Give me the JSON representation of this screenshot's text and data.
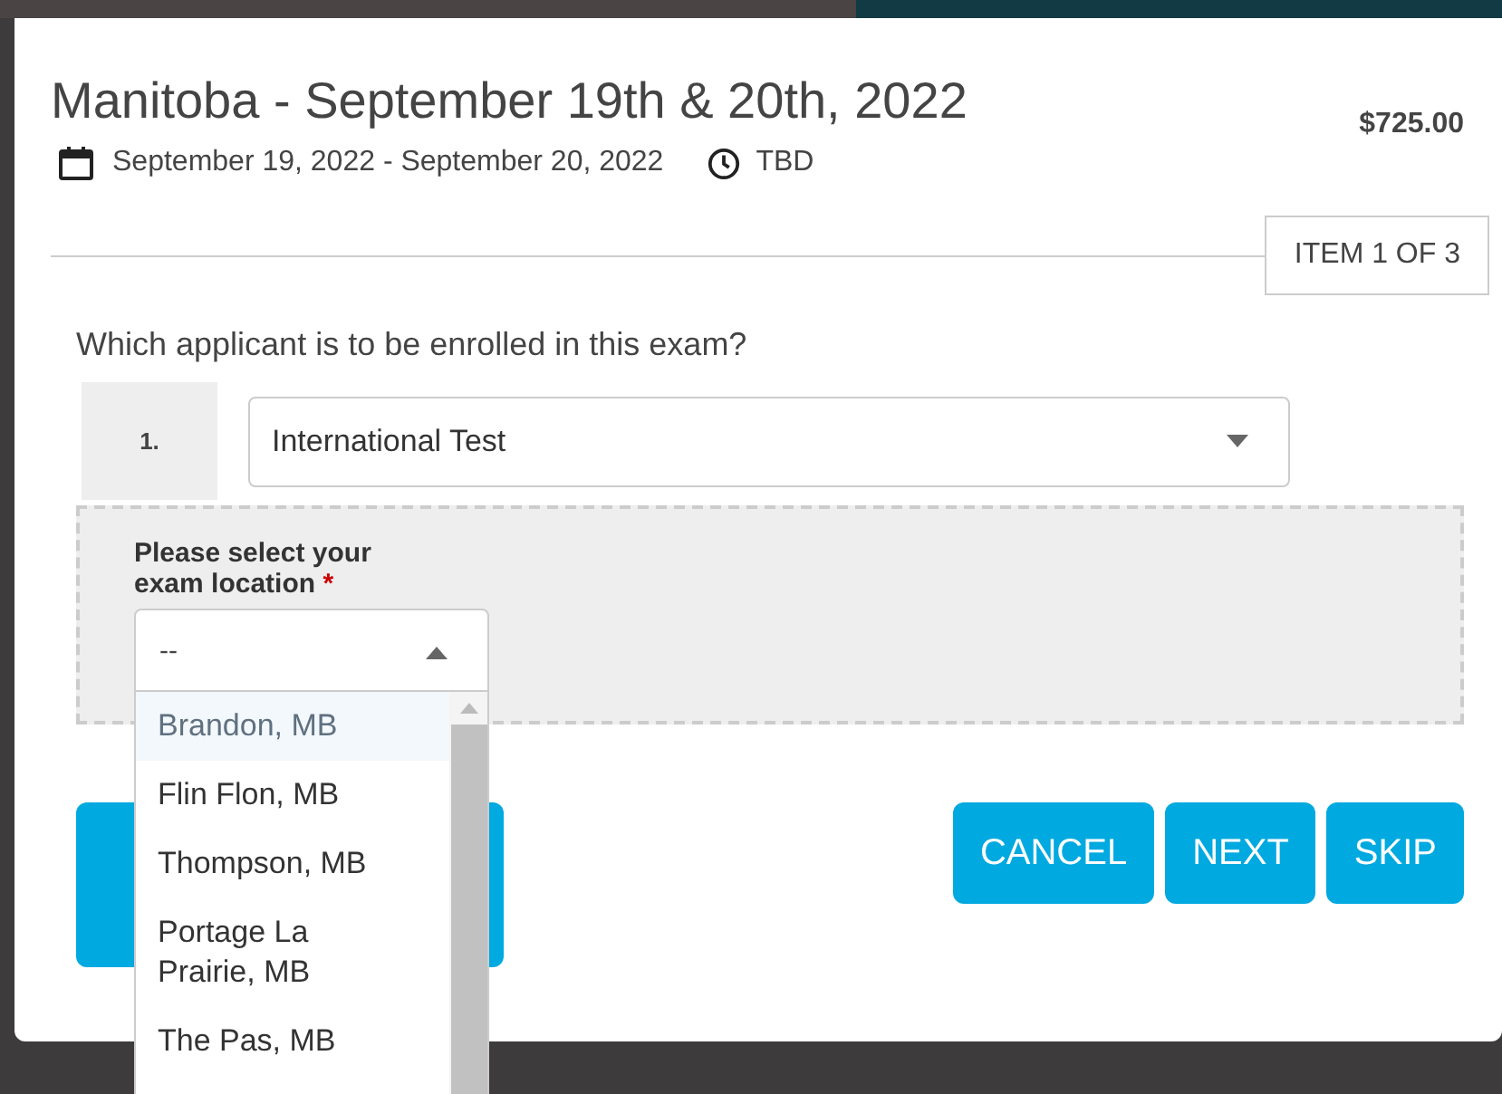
{
  "header": {
    "title": "Manitoba - September 19th & 20th, 2022",
    "price": "$725.00",
    "dates": "September 19, 2022 - September 20, 2022",
    "time": "TBD"
  },
  "progress": "ITEM 1 OF 3",
  "question": "Which applicant is to be enrolled in this exam?",
  "applicant": {
    "number": "1.",
    "value": "International Test"
  },
  "location": {
    "label": "Please select your exam location",
    "required_mark": "*",
    "value": "--",
    "expanded": true,
    "options": [
      {
        "label": "Brandon, MB",
        "highlighted": true
      },
      {
        "label": "Flin Flon, MB",
        "highlighted": false
      },
      {
        "label": "Thompson, MB",
        "highlighted": false
      },
      {
        "label": "Portage La Prairie, MB",
        "highlighted": false
      },
      {
        "label": "The Pas, MB",
        "highlighted": false
      }
    ]
  },
  "buttons": [
    "CANCEL",
    "NEXT",
    "SKIP"
  ]
}
